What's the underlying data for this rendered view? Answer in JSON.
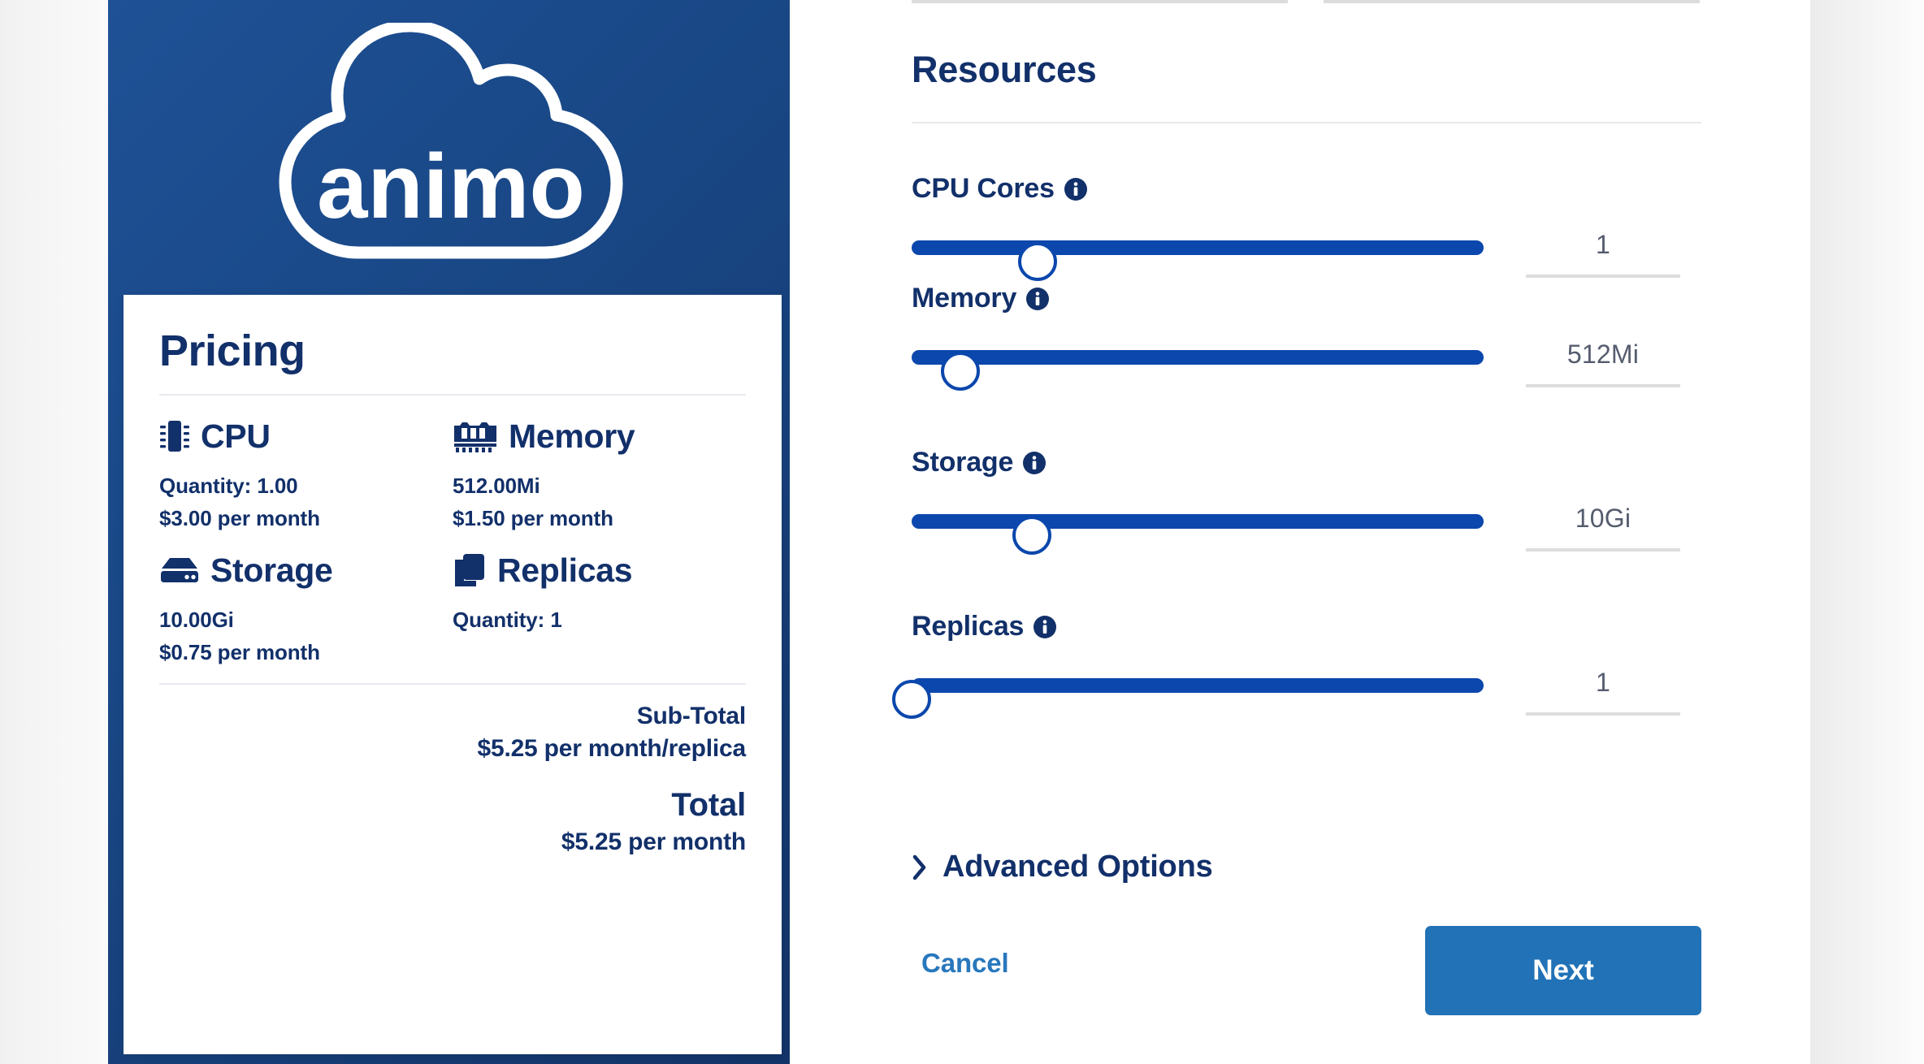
{
  "brand": {
    "logo_text": "animo",
    "logo_icon": "cloud-icon",
    "panel_color_start": "#1e5196",
    "panel_color_end": "#133468"
  },
  "pricing": {
    "title": "Pricing",
    "items": [
      {
        "icon": "cpu-chip-icon",
        "label": "CPU",
        "quantity": "Quantity: 1.00",
        "cost": "$3.00 per month"
      },
      {
        "icon": "memory-stick-icon",
        "label": "Memory",
        "quantity": "512.00Mi",
        "cost": "$1.50 per month"
      },
      {
        "icon": "hard-drive-icon",
        "label": "Storage",
        "quantity": "10.00Gi",
        "cost": "$0.75 per month"
      },
      {
        "icon": "copy-stack-icon",
        "label": "Replicas",
        "quantity": "Quantity: 1",
        "cost": ""
      }
    ],
    "subtotal_label": "Sub-Total",
    "subtotal_value": "$5.25 per month/replica",
    "total_label": "Total",
    "total_value": "$5.25 per month"
  },
  "form": {
    "section_title": "Resources",
    "fields": [
      {
        "label": "CPU Cores",
        "info_icon": "info-icon",
        "value": "1",
        "thumb_percent": 22
      },
      {
        "label": "Memory",
        "info_icon": "info-icon",
        "value": "512Mi",
        "thumb_percent": 8.5
      },
      {
        "label": "Storage",
        "info_icon": "info-icon",
        "value": "10Gi",
        "thumb_percent": 21
      },
      {
        "label": "Replicas",
        "info_icon": "info-icon",
        "value": "1",
        "thumb_percent": 0
      }
    ],
    "advanced_options_label": "Advanced Options",
    "advanced_chevron_icon": "chevron-right-icon",
    "cancel_label": "Cancel",
    "next_label": "Next",
    "accent_color": "#0b47ac",
    "next_button_color": "#2172b6",
    "link_color": "#2878bd"
  }
}
